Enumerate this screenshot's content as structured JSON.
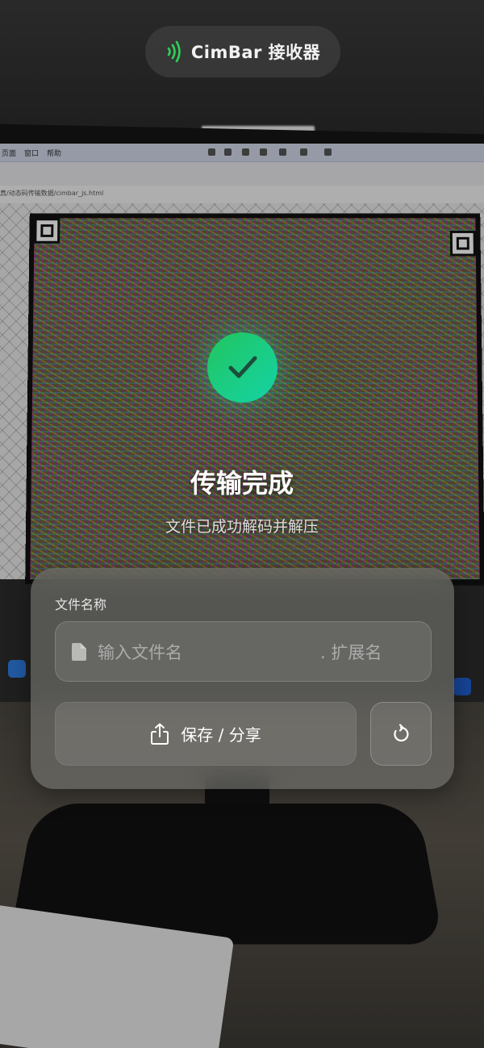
{
  "header": {
    "app_title": "CimBar 接收器",
    "icon": "signal-waves-icon",
    "accent": "#2fd158"
  },
  "status": {
    "icon": "check-icon",
    "title": "传输完成",
    "subtitle": "文件已成功解码并解压"
  },
  "form": {
    "filename_label": "文件名称",
    "filename_placeholder": "输入文件名",
    "extension_placeholder": ". 扩展名",
    "file_icon": "document-icon",
    "save_icon": "share-icon",
    "save_label": "保存 / 分享",
    "reset_icon": "reset-icon"
  },
  "colors": {
    "success_start": "#22c55e",
    "success_end": "#14d3a6"
  },
  "background_screen": {
    "menu_items": [
      "页面",
      "窗口",
      "帮助"
    ],
    "url": "真/动态码传输数据/cimbar_js.html"
  }
}
